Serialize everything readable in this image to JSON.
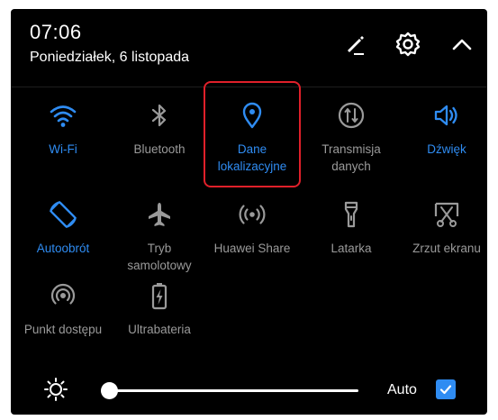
{
  "status": {
    "time": "07:06",
    "date": "Poniedziałek, 6 listopada"
  },
  "header_icons": [
    {
      "name": "edit-icon"
    },
    {
      "name": "settings-gear-icon"
    },
    {
      "name": "collapse-chevron-up-icon"
    }
  ],
  "tiles": {
    "wifi": {
      "label": "Wi-Fi",
      "active": true,
      "icon": "wifi-icon"
    },
    "bluetooth": {
      "label": "Bluetooth",
      "active": false,
      "icon": "bluetooth-icon"
    },
    "location": {
      "label": "Dane\nlokalizacyjne",
      "active": true,
      "icon": "location-pin-icon"
    },
    "mobile_data": {
      "label": "Transmisja\ndanych",
      "active": false,
      "icon": "mobile-data-icon"
    },
    "sound": {
      "label": "Dźwięk",
      "active": true,
      "icon": "speaker-icon"
    },
    "autorotate": {
      "label": "Autoobrót",
      "active": true,
      "icon": "auto-rotate-icon"
    },
    "airplane": {
      "label": "Tryb\nsamolotowy",
      "active": false,
      "icon": "airplane-icon"
    },
    "huawei_share": {
      "label": "Huawei Share",
      "active": false,
      "icon": "huawei-share-icon"
    },
    "flashlight": {
      "label": "Latarka",
      "active": false,
      "icon": "flashlight-icon"
    },
    "screenshot": {
      "label": "Zrzut ekranu",
      "active": false,
      "icon": "screenshot-scissors-icon"
    },
    "hotspot": {
      "label": "Punkt dostępu",
      "active": false,
      "icon": "hotspot-icon"
    },
    "ultra_battery": {
      "label": "Ultrabateria",
      "active": false,
      "icon": "ultra-battery-icon"
    }
  },
  "brightness": {
    "level": 0.0,
    "auto_label": "Auto",
    "auto_checked": true
  },
  "colors": {
    "accent": "#2f8cf2",
    "inactive": "#9a9a9a",
    "highlight_box": "#e0202a",
    "background": "#000000"
  }
}
